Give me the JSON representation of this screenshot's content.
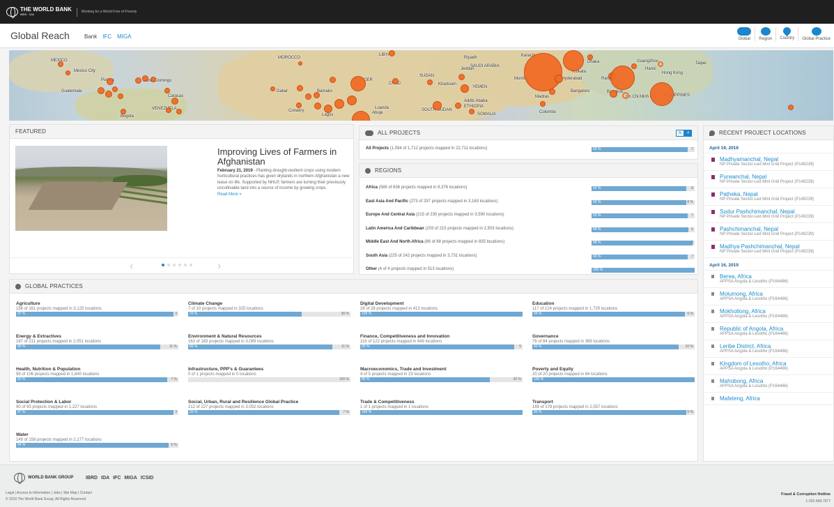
{
  "topbar": {
    "logo_name": "THE WORLD BANK",
    "logo_sub": "IBRD · IDA",
    "tagline": "Working for a World Free of Poverty"
  },
  "header": {
    "title": "Global Reach",
    "nav": [
      "Bank",
      "IFC",
      "MIGA"
    ],
    "views": [
      {
        "label": "Global",
        "icon": "global-icon"
      },
      {
        "label": "Region",
        "icon": "region-icon"
      },
      {
        "label": "Country",
        "icon": "country-pin-icon"
      },
      {
        "label": "Global Practice",
        "icon": "global-practice-icon"
      }
    ]
  },
  "map": {
    "labels": [
      "MEXICO",
      "Mexico City",
      "Puebla",
      "Santo Domingo",
      "Guatemala",
      "Caracas",
      "VENEZUELA",
      "Bogota",
      "MOROCCO",
      "Dakar",
      "Bamako",
      "Conakry",
      "LIBYA",
      "NIGER",
      "CHAD",
      "SUDAN",
      "Khartoum",
      "YEMEN",
      "Riyadh",
      "Jeddah",
      "SAUDI ARABIA",
      "Addis Ababa",
      "ETHIOPIA",
      "SOUTH SUDAN",
      "SOMALIA",
      "Lagos",
      "Abuja",
      "Luanda",
      "Karachi",
      "Mumbai",
      "Kolkata",
      "Hyderabad",
      "Bangalore",
      "Madras",
      "Colombo",
      "Dhaka",
      "Rangoon",
      "Bangkok",
      "Guangzhou",
      "Hong Kong",
      "Taipei",
      "Hanoi",
      "Ho Chi Minh City",
      "PHILIPPINES"
    ]
  },
  "featured": {
    "heading": "Featured",
    "title": "Improving Lives of Farmers in Afghanistan",
    "date": "February 21, 2019",
    "body": " - Planting drought-resilient crops using modern horticultural practices has given drylands in northern Afghanistan a new lease on life. Supported by NHLP, farmers are turning their previously uncultivable land into a source of income by growing crops.",
    "more": "Read More »",
    "pager": {
      "prev": "‹",
      "next": "›",
      "count": 6,
      "active": 0
    }
  },
  "all_projects": {
    "heading": "All Projects",
    "toggle": [
      "%",
      "#"
    ],
    "row": {
      "name": "All Projects",
      "detail": " (1,594 of 1,712 projects mapped in 22,711 locations)",
      "pct": "93 %",
      "fill": 93,
      "rest": "7"
    }
  },
  "regions": {
    "heading": "Regions",
    "rows": [
      {
        "name": "Africa",
        "detail": " (588 of 636 projects mapped in 8,376 locations)",
        "pct": "92 %",
        "fill": 92,
        "rest": "8"
      },
      {
        "name": "East Asia And Pacific",
        "detail": " (273 of 297 projects mapped in 3,163 locations)",
        "pct": "92 %",
        "fill": 92,
        "rest": "8 %"
      },
      {
        "name": "Europe And Central Asia",
        "detail": " (215 of 230 projects mapped in 3,590 locations)",
        "pct": "93 %",
        "fill": 93,
        "rest": "7"
      },
      {
        "name": "Latin America And Caribbean",
        "detail": " (203 of 215 projects mapped in 2,503 locations)",
        "pct": "94 %",
        "fill": 94,
        "rest": "6"
      },
      {
        "name": "Middle East And North Africa",
        "detail": " (86 of 88 projects mapped in 835 locations)",
        "pct": "98 %",
        "fill": 98,
        "rest": "2"
      },
      {
        "name": "South Asia",
        "detail": " (225 of 242 projects mapped in 3,731 locations)",
        "pct": "93 %",
        "fill": 93,
        "rest": "7"
      },
      {
        "name": "Other",
        "detail": " (4 of 4 projects mapped in 513 locations)",
        "pct": "100 %",
        "fill": 100,
        "rest": ""
      }
    ]
  },
  "practices": {
    "heading": "Global Practices",
    "items": [
      {
        "title": "Agriculture",
        "sub": "156 of 161 projects mapped in 3,125 locations",
        "pct": "97 %",
        "fill": 97,
        "rest": "3"
      },
      {
        "title": "Climate Change",
        "sub": "7 of 10 projects mapped in 325 locations",
        "pct": "70 %",
        "fill": 70,
        "rest": "30 %"
      },
      {
        "title": "Digital Development",
        "sub": "28 of 28 projects mapped in 413 locations",
        "pct": "100 %",
        "fill": 100,
        "rest": ""
      },
      {
        "title": "Education",
        "sub": "117 of 124 projects mapped in 1,729 locations",
        "pct": "94 %",
        "fill": 94,
        "rest": "6 %"
      },
      {
        "title": "Energy & Extractives",
        "sub": "187 of 211 projects mapped in 2,051 locations",
        "pct": "89 %",
        "fill": 89,
        "rest": "11 %"
      },
      {
        "title": "Environment & Natural Resources",
        "sub": "163 of 183 projects mapped in 3,089 locations",
        "pct": "89 %",
        "fill": 89,
        "rest": "11 %"
      },
      {
        "title": "Finance, Competitiveness and Innovation",
        "sub": "116 of 122 projects mapped in 649 locations",
        "pct": "95 %",
        "fill": 95,
        "rest": "5"
      },
      {
        "title": "Governance",
        "sub": "76 of 84 projects mapped in 369 locations",
        "pct": "90 %",
        "fill": 90,
        "rest": "10 %"
      },
      {
        "title": "Health, Nutrition & Population",
        "sub": "99 of 106 projects mapped in 1,840 locations",
        "pct": "93 %",
        "fill": 93,
        "rest": "7 %"
      },
      {
        "title": "Infrastructure, PPP's & Guarantees",
        "sub": "0 of 1 projects mapped in 0 locations",
        "pct": "",
        "fill": 0,
        "rest": "100 %"
      },
      {
        "title": "Macroeconomics, Trade and Investment",
        "sub": "4 of 5 projects mapped in 23 locations",
        "pct": "80 %",
        "fill": 80,
        "rest": "20 %"
      },
      {
        "title": "Poverty and Equity",
        "sub": "20 of 20 projects mapped in 84 locations",
        "pct": "100 %",
        "fill": 100,
        "rest": ""
      },
      {
        "title": "Social Protection & Labor",
        "sub": "90 of 93 projects mapped in 1,227 locations",
        "pct": "97 %",
        "fill": 97,
        "rest": "3"
      },
      {
        "title": "Social, Urban, Rural and Resilience Global Practice",
        "sub": "212 of 227 projects mapped in 3,052 locations",
        "pct": "93 %",
        "fill": 93,
        "rest": "7 %"
      },
      {
        "title": "Trade & Competitiveness",
        "sub": "1 of 1 projects mapped in 1 locations",
        "pct": "100 %",
        "fill": 100,
        "rest": ""
      },
      {
        "title": "Transport",
        "sub": "169 of 178 projects mapped in 2,557 locations",
        "pct": "95 %",
        "fill": 95,
        "rest": "5 %"
      },
      {
        "title": "Water",
        "sub": "149 of 158 projects mapped in 2,177 locations",
        "pct": "94 %",
        "fill": 94,
        "rest": "6 %"
      }
    ]
  },
  "recent": {
    "heading": "Recent Project Locations",
    "groups": [
      {
        "date": "April 19, 2019",
        "icon": "project-marker-icon",
        "items": [
          {
            "name": "Madhyamanchal, Nepal",
            "desc": "NP Private Sector-Led Mini Grid Project (P149239)"
          },
          {
            "name": "Purwanchal, Nepal",
            "desc": "NP Private Sector-Led Mini Grid Project (P149239)"
          },
          {
            "name": "Patheka, Nepal",
            "desc": "NP Private Sector-Led Mini Grid Project (P149239)"
          },
          {
            "name": "Sudur Pashchimanchal, Nepal",
            "desc": "NP Private Sector-Led Mini Grid Project (P149239)"
          },
          {
            "name": "Pashchimanchal, Nepal",
            "desc": "NP Private Sector-Led Mini Grid Project (P149239)"
          },
          {
            "name": "Madhya Pashchimanchal, Nepal",
            "desc": "NP Private Sector-Led Mini Grid Project (P149239)"
          }
        ]
      },
      {
        "date": "April 16, 2019",
        "icon": "flag-icon",
        "items": [
          {
            "name": "Berea, Africa",
            "desc": "APPSA Angola & Lesotho (P164486)"
          },
          {
            "name": "Molumong, Africa",
            "desc": "APPSA Angola & Lesotho (P164486)"
          },
          {
            "name": "Mokhotlong, Africa",
            "desc": "APPSA Angola & Lesotho (P164486)"
          },
          {
            "name": "Republic of Angola, Africa",
            "desc": "APPSA Angola & Lesotho (P164486)"
          },
          {
            "name": "Leribe District, Africa",
            "desc": "APPSA Angola & Lesotho (P164486)"
          },
          {
            "name": "Kingdom of Lesotho, Africa",
            "desc": "APPSA Angola & Lesotho (P164486)"
          },
          {
            "name": "Mahobong, Africa",
            "desc": "APPSA Angola & Lesotho (P164486)"
          },
          {
            "name": "Mafeteng, Africa",
            "desc": ""
          }
        ]
      }
    ]
  },
  "footer": {
    "group_name": "WORLD BANK GROUP",
    "institutions": [
      "IBRD",
      "IDA",
      "IFC",
      "MIGA",
      "ICSID"
    ],
    "links": "Legal  |  Access to Information  |  Jobs  |  Site Map  |  Contact",
    "copyright": "© 2019 The World Bank Group, All Rights Reserved.",
    "fraud": "Fraud & Corruption Hotline",
    "phone": "1-202-458-7677"
  },
  "colors": {
    "accent": "#1c85cb",
    "bar": "#6ea8d3",
    "dot": "#f16b24",
    "topbar": "#1f1f1f"
  }
}
